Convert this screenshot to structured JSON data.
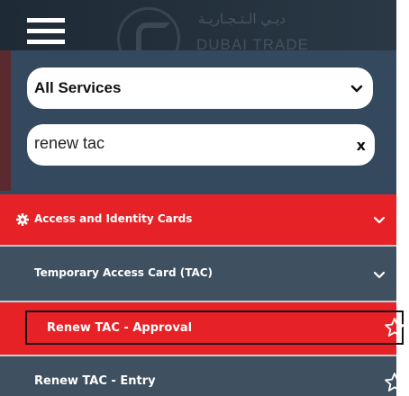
{
  "header": {
    "logo_arabic": "ديـي الـتـجـاريـة",
    "logo_english": "DUBAI TRADE"
  },
  "filter": {
    "selected_service": "All Services",
    "search_value": "renew tac",
    "clear_label": "x"
  },
  "menu": {
    "category": {
      "label": "Access and Identity Cards",
      "icon": "gear-icon"
    },
    "subcategory": {
      "label": "Temporary Access Card (TAC)"
    },
    "items": [
      {
        "label": "Renew TAC - Approval",
        "selected": true,
        "icon": "star-outline-icon"
      },
      {
        "label": "Renew TAC - Entry",
        "selected": false,
        "icon": "star-outline-icon"
      }
    ]
  },
  "colors": {
    "accent_red": "#e62227",
    "panel_slate": "#34495e",
    "row_slate": "#3f5060",
    "text_white": "#ffffff"
  }
}
